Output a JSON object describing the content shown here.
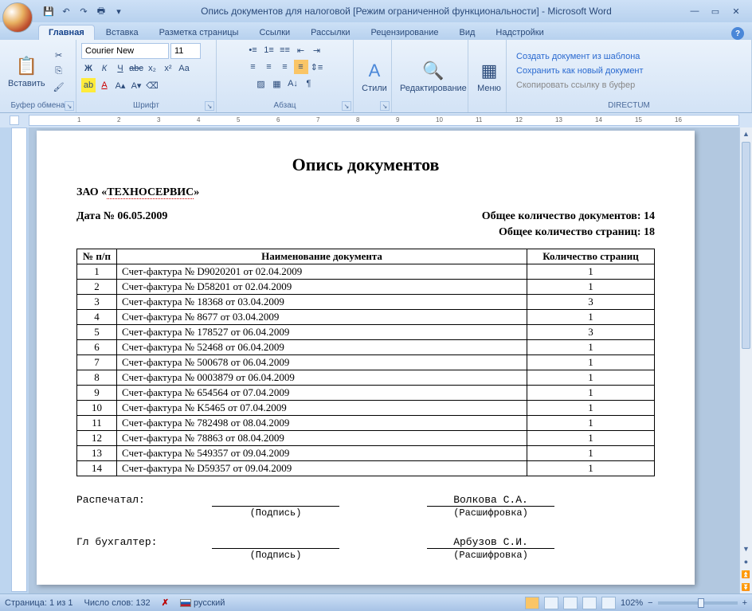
{
  "title": "Опись документов для налоговой [Режим ограниченной функциональности] - Microsoft Word",
  "tabs": [
    "Главная",
    "Вставка",
    "Разметка страницы",
    "Ссылки",
    "Рассылки",
    "Рецензирование",
    "Вид",
    "Надстройки"
  ],
  "ribbon": {
    "clipboard": {
      "paste": "Вставить",
      "label": "Буфер обмена"
    },
    "font": {
      "name": "Courier New",
      "size": "11",
      "label": "Шрифт"
    },
    "paragraph": {
      "label": "Абзац"
    },
    "styles": {
      "label": "Стили"
    },
    "editing": {
      "label": "Редактирование"
    },
    "menu": {
      "label": "Меню"
    },
    "directum": {
      "create": "Создать документ из шаблона",
      "save": "Сохранить как новый документ",
      "copy": "Скопировать ссылку в буфер",
      "label": "DIRECTUM"
    }
  },
  "document": {
    "heading": "Опись документов",
    "company_prefix": "ЗАО «",
    "company": "ТЕХНОСЕРВИС",
    "company_suffix": "»",
    "date_label": "Дата № ",
    "date": "06.05.2009",
    "total_docs_label": "Общее количество документов: ",
    "total_docs": "14",
    "total_pages_label": "Общее количество страниц: ",
    "total_pages": "18",
    "th_num": "№ п/п",
    "th_name": "Наименование документа",
    "th_pages": "Количество страниц",
    "rows": [
      {
        "n": "1",
        "name": "Счет-фактура № D9020201 от 02.04.2009",
        "p": "1"
      },
      {
        "n": "2",
        "name": "Счет-фактура № D58201 от 02.04.2009",
        "p": "1"
      },
      {
        "n": "3",
        "name": "Счет-фактура № 18368 от 03.04.2009",
        "p": "3"
      },
      {
        "n": "4",
        "name": "Счет-фактура № 8677 от 03.04.2009",
        "p": "1"
      },
      {
        "n": "5",
        "name": "Счет-фактура № 178527 от 06.04.2009",
        "p": "3"
      },
      {
        "n": "6",
        "name": "Счет-фактура № 52468 от 06.04.2009",
        "p": "1"
      },
      {
        "n": "7",
        "name": "Счет-фактура № 500678 от 06.04.2009",
        "p": "1"
      },
      {
        "n": "8",
        "name": "Счет-фактура № 0003879 от 06.04.2009",
        "p": "1"
      },
      {
        "n": "9",
        "name": "Счет-фактура № 654564 от 07.04.2009",
        "p": "1"
      },
      {
        "n": "10",
        "name": "Счет-фактура № K5465 от 07.04.2009",
        "p": "1"
      },
      {
        "n": "11",
        "name": "Счет-фактура № 782498 от 08.04.2009",
        "p": "1"
      },
      {
        "n": "12",
        "name": "Счет-фактура № 78863 от 08.04.2009",
        "p": "1"
      },
      {
        "n": "13",
        "name": "Счет-фактура № 549357 от 09.04.2009",
        "p": "1"
      },
      {
        "n": "14",
        "name": "Счет-фактура № D59357 от 09.04.2009",
        "p": "1"
      }
    ],
    "printed_label": "Распечатал:",
    "sign_caption": "(Подпись)",
    "decode_caption": "(Расшифровка)",
    "printed_name": "Волкова С.А.",
    "accountant_label": "Гл бухгалтер:",
    "accountant_name": "Арбузов С.И."
  },
  "status": {
    "page": "Страница: 1 из 1",
    "words": "Число слов: 132",
    "lang": "русский",
    "zoom": "102%"
  }
}
